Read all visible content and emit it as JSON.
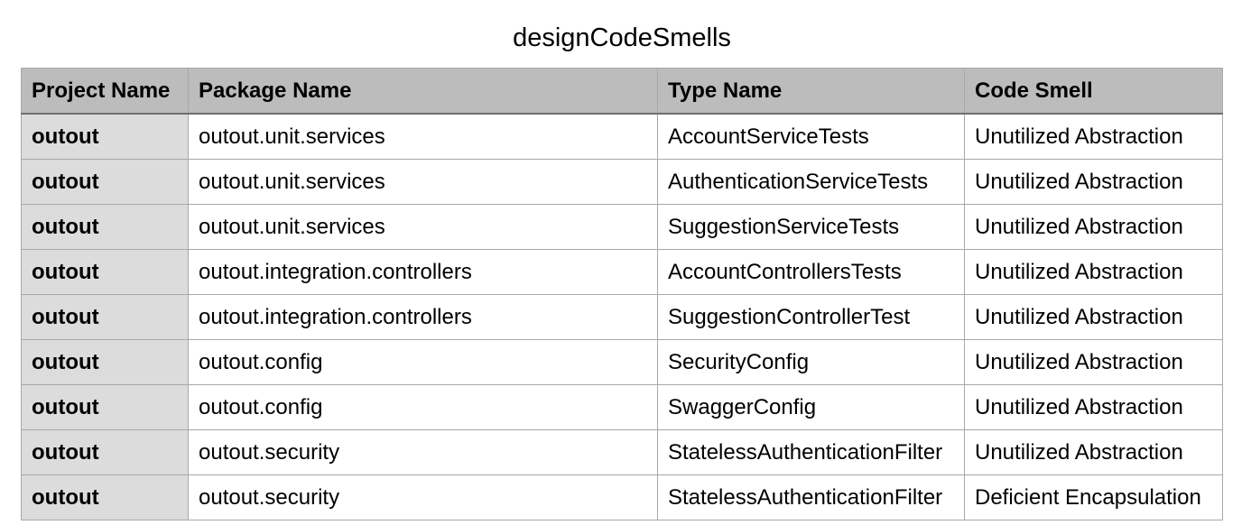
{
  "title": "designCodeSmells",
  "columns": [
    "Project Name",
    "Package Name",
    "Type Name",
    "Code Smell"
  ],
  "rows": [
    [
      "outout",
      "outout.unit.services",
      "AccountServiceTests",
      "Unutilized Abstraction"
    ],
    [
      "outout",
      "outout.unit.services",
      "AuthenticationServiceTests",
      "Unutilized Abstraction"
    ],
    [
      "outout",
      "outout.unit.services",
      "SuggestionServiceTests",
      "Unutilized Abstraction"
    ],
    [
      "outout",
      "outout.integration.controllers",
      "AccountControllersTests",
      "Unutilized Abstraction"
    ],
    [
      "outout",
      "outout.integration.controllers",
      "SuggestionControllerTest",
      "Unutilized Abstraction"
    ],
    [
      "outout",
      "outout.config",
      "SecurityConfig",
      "Unutilized Abstraction"
    ],
    [
      "outout",
      "outout.config",
      "SwaggerConfig",
      "Unutilized Abstraction"
    ],
    [
      "outout",
      "outout.security",
      "StatelessAuthenticationFilter",
      "Unutilized Abstraction"
    ],
    [
      "outout",
      "outout.security",
      "StatelessAuthenticationFilter",
      "Deficient Encapsulation"
    ]
  ]
}
